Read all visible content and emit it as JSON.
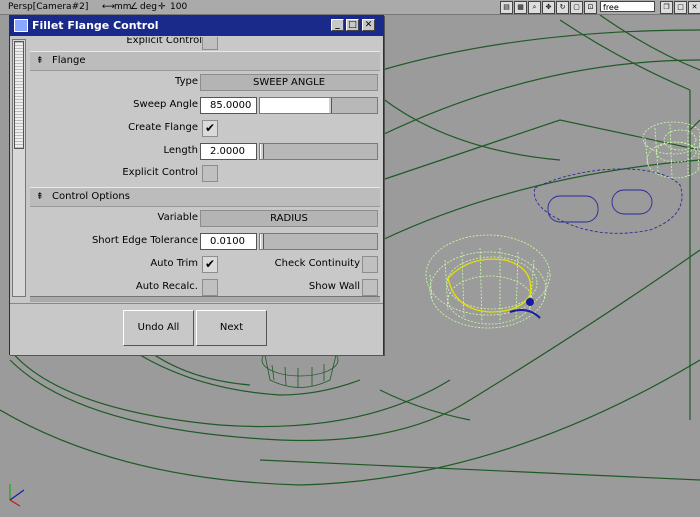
{
  "viewport": {
    "camera_label": "Persp[Camera#2]",
    "unit_length": "mm",
    "unit_angle": "deg",
    "scale": "100",
    "mode_field": "free",
    "bg_color": "#9b9b9b",
    "wire_dark": "#1f5a26",
    "wire_light": "#caffa8",
    "curve_blue": "#1a1aa0",
    "curve_yellow": "#e8e000"
  },
  "dialog": {
    "title": "Fillet Flange Control",
    "title_color": "#1a2a8a",
    "partial_label": "Explicit Control",
    "flange": {
      "section_title": "Flange",
      "type_label": "Type",
      "type_value": "SWEEP ANGLE",
      "sweep_label": "Sweep Angle",
      "sweep_value": "85.0000",
      "sweep_slider_fraction": 0.6,
      "create_label": "Create Flange",
      "create_checked": true,
      "length_label": "Length",
      "length_value": "2.0000",
      "length_slider_fraction": 0.0,
      "explicit_label": "Explicit Control",
      "explicit_checked": false
    },
    "control": {
      "section_title": "Control Options",
      "variable_label": "Variable",
      "variable_value": "RADIUS",
      "tolerance_label": "Short Edge Tolerance",
      "tolerance_value": "0.0100",
      "tolerance_slider_fraction": 0.0,
      "autotrim_label": "Auto Trim",
      "autotrim_checked": true,
      "continuity_label": "Check Continuity",
      "continuity_checked": false,
      "recalc_label": "Auto Recalc.",
      "recalc_checked": false,
      "showwall_label": "Show Wall",
      "showwall_checked": false
    },
    "buttons": {
      "undo_all": "Undo All",
      "next": "Next"
    },
    "check_glyph": "✔"
  }
}
